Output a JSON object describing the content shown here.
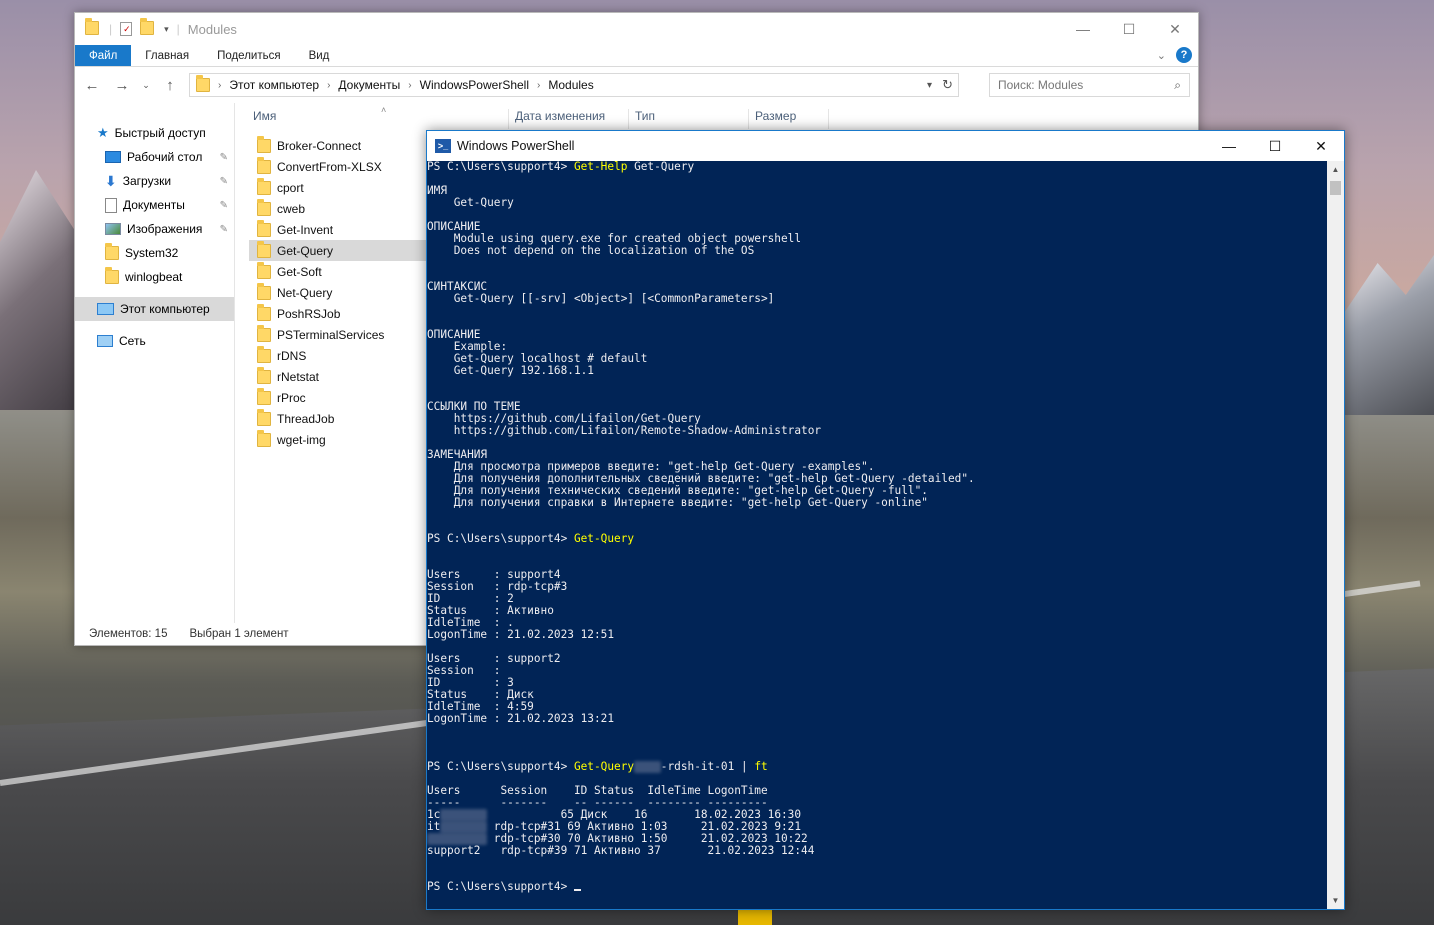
{
  "explorer": {
    "title": "Modules",
    "ribbon_tabs": [
      "Файл",
      "Главная",
      "Поделиться",
      "Вид"
    ],
    "breadcrumb": [
      "Этот компьютер",
      "Документы",
      "WindowsPowerShell",
      "Modules"
    ],
    "search_placeholder": "Поиск: Modules",
    "nav_items": [
      {
        "label": "Быстрый доступ",
        "icon": "star-icon"
      },
      {
        "label": "Рабочий стол",
        "icon": "desktop-icon",
        "pinned": true
      },
      {
        "label": "Загрузки",
        "icon": "download-icon",
        "pinned": true
      },
      {
        "label": "Документы",
        "icon": "documents-icon",
        "pinned": true
      },
      {
        "label": "Изображения",
        "icon": "pictures-icon",
        "pinned": true
      },
      {
        "label": "System32",
        "icon": "folder-icon"
      },
      {
        "label": "winlogbeat",
        "icon": "folder-icon"
      },
      {
        "label": "Этот компьютер",
        "icon": "computer-icon",
        "selected": true
      },
      {
        "label": "Сеть",
        "icon": "network-icon"
      }
    ],
    "columns": [
      "Имя",
      "Дата изменения",
      "Тип",
      "Размер"
    ],
    "files": [
      "Broker-Connect",
      "ConvertFrom-XLSX",
      "cport",
      "cweb",
      "Get-Invent",
      "Get-Query",
      "Get-Soft",
      "Net-Query",
      "PoshRSJob",
      "PSTerminalServices",
      "rDNS",
      "rNetstat",
      "rProc",
      "ThreadJob",
      "wget-img"
    ],
    "selected_file": "Get-Query",
    "status_items": "Элементов: 15",
    "status_selected": "Выбран 1 элемент"
  },
  "powershell": {
    "title": "Windows PowerShell",
    "console_lines": [
      {
        "prompt": "PS C:\\Users\\support4> ",
        "cmd": "Get-Help",
        "rest": " Get-Query"
      },
      {
        "text": ""
      },
      {
        "text": "ИМЯ"
      },
      {
        "text": "    Get-Query"
      },
      {
        "text": ""
      },
      {
        "text": "ОПИСАНИЕ"
      },
      {
        "text": "    Module using query.exe for created object powershell"
      },
      {
        "text": "    Does not depend on the localization of the OS"
      },
      {
        "text": ""
      },
      {
        "text": ""
      },
      {
        "text": "СИНТАКСИС"
      },
      {
        "text": "    Get-Query [[-srv] <Object>] [<CommonParameters>]"
      },
      {
        "text": ""
      },
      {
        "text": ""
      },
      {
        "text": "ОПИСАНИЕ"
      },
      {
        "text": "    Example:"
      },
      {
        "text": "    Get-Query localhost # default"
      },
      {
        "text": "    Get-Query 192.168.1.1"
      },
      {
        "text": ""
      },
      {
        "text": ""
      },
      {
        "text": "ССЫЛКИ ПО ТЕМЕ"
      },
      {
        "text": "    https://github.com/Lifailon/Get-Query"
      },
      {
        "text": "    https://github.com/Lifailon/Remote-Shadow-Administrator"
      },
      {
        "text": ""
      },
      {
        "text": "ЗАМЕЧАНИЯ"
      },
      {
        "text": "    Для просмотра примеров введите: \"get-help Get-Query -examples\"."
      },
      {
        "text": "    Для получения дополнительных сведений введите: \"get-help Get-Query -detailed\"."
      },
      {
        "text": "    Для получения технических сведений введите: \"get-help Get-Query -full\"."
      },
      {
        "text": "    Для получения справки в Интернете введите: \"get-help Get-Query -online\""
      },
      {
        "text": ""
      },
      {
        "text": ""
      },
      {
        "prompt": "PS C:\\Users\\support4> ",
        "cmd": "Get-Query",
        "rest": ""
      },
      {
        "text": ""
      },
      {
        "text": ""
      },
      {
        "text": "Users     : support4"
      },
      {
        "text": "Session   : rdp-tcp#3"
      },
      {
        "text": "ID        : 2"
      },
      {
        "text": "Status    : Активно"
      },
      {
        "text": "IdleTime  : ."
      },
      {
        "text": "LogonTime : 21.02.2023 12:51"
      },
      {
        "text": ""
      },
      {
        "text": "Users     : support2"
      },
      {
        "text": "Session   :"
      },
      {
        "text": "ID        : 3"
      },
      {
        "text": "Status    : Диск"
      },
      {
        "text": "IdleTime  : 4:59"
      },
      {
        "text": "LogonTime : 21.02.2023 13:21"
      },
      {
        "text": ""
      },
      {
        "text": ""
      },
      {
        "text": ""
      },
      {
        "prompt": "PS C:\\Users\\support4> ",
        "cmd": "Get-Query",
        "blurred": "    ",
        "rest": "-rdsh-it-01 | ",
        "cmd2": "ft"
      },
      {
        "text": ""
      },
      {
        "text": "Users      Session    ID Status  IdleTime LogonTime"
      },
      {
        "text": "-----      -------    -- ------  -------- ---------"
      },
      {
        "lead": "1c",
        "blur": "       ",
        "tail": "           65 Диск    16       18.02.2023 16:30"
      },
      {
        "lead": "it",
        "blur": "       ",
        "tail": " rdp-tcp#31 69 Активно 1:03     21.02.2023 9:21"
      },
      {
        "lead": "",
        "blur": "         ",
        "tail": " rdp-tcp#30 70 Активно 1:50     21.02.2023 10:22"
      },
      {
        "text": "support2   rdp-tcp#39 71 Активно 37       21.02.2023 12:44"
      },
      {
        "text": ""
      },
      {
        "text": ""
      },
      {
        "prompt": "PS C:\\Users\\support4> ",
        "cursor": true
      }
    ]
  }
}
